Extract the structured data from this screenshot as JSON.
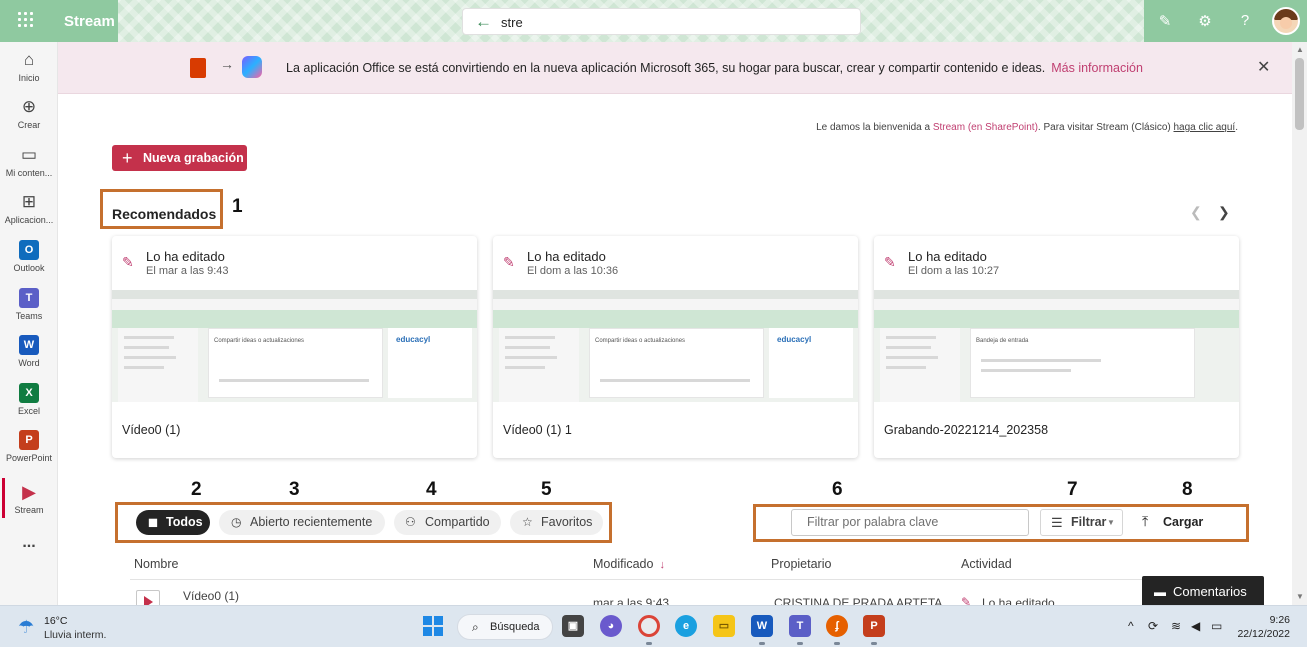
{
  "header": {
    "app_name": "Stream",
    "search_value": "stre",
    "icons": [
      "waffle-icon",
      "back-arrow-icon",
      "whats-new-icon",
      "settings-icon",
      "help-icon",
      "avatar"
    ]
  },
  "left_nav": {
    "items": [
      {
        "label": "Inicio",
        "icon": "home-icon"
      },
      {
        "label": "Crear",
        "icon": "create-icon"
      },
      {
        "label": "Mi conten...",
        "icon": "folder-icon"
      },
      {
        "label": "Aplicacion...",
        "icon": "apps-icon"
      },
      {
        "label": "Outlook",
        "icon": "outlook-icon"
      },
      {
        "label": "Teams",
        "icon": "teams-icon"
      },
      {
        "label": "Word",
        "icon": "word-icon"
      },
      {
        "label": "Excel",
        "icon": "excel-icon"
      },
      {
        "label": "PowerPoint",
        "icon": "powerpoint-icon"
      },
      {
        "label": "Stream",
        "icon": "stream-icon"
      }
    ],
    "more": "..."
  },
  "banner": {
    "text": "La aplicación Office se está convirtiendo en la nueva aplicación Microsoft 365, su hogar para buscar, crear y compartir contenido e ideas.",
    "link": "Más información"
  },
  "welcome": {
    "prefix": "Le damos la bienvenida a ",
    "link": "Stream (en SharePoint)",
    "middle": ". Para visitar Stream (Clásico) ",
    "action": "haga clic aquí",
    "suffix": "."
  },
  "new_recording_label": "Nueva grabación",
  "recommended": {
    "title": "Recomendados",
    "cards": [
      {
        "action": "Lo ha editado",
        "date": "El mar a las 9:43",
        "title": "Vídeo0 (1)",
        "thumb_heading": "Compartir ideas o actualizaciones"
      },
      {
        "action": "Lo ha editado",
        "date": "El dom a las 10:36",
        "title": "Vídeo0 (1) 1",
        "thumb_heading": "Compartir ideas o actualizaciones"
      },
      {
        "action": "Lo ha editado",
        "date": "El dom a las 10:27",
        "title": "Grabando-20221214_202358",
        "thumb_heading": "Bandeja de entrada"
      }
    ],
    "thumb_brand": "educacyl"
  },
  "filter_pills": [
    {
      "label": "Todos",
      "icon": "cube-icon",
      "active": true
    },
    {
      "label": "Abierto recientemente",
      "icon": "clock-icon",
      "active": false
    },
    {
      "label": "Compartido",
      "icon": "people-icon",
      "active": false
    },
    {
      "label": "Favoritos",
      "icon": "star-icon",
      "active": false
    }
  ],
  "toolbar": {
    "filter_placeholder": "Filtrar por palabra clave",
    "filter_label": "Filtrar",
    "upload_label": "Cargar"
  },
  "annotations": [
    "1",
    "2",
    "3",
    "4",
    "5",
    "6",
    "7",
    "8"
  ],
  "table": {
    "columns": [
      "Nombre",
      "Modificado",
      "Propietario",
      "Actividad"
    ],
    "rows": [
      {
        "name": "Vídeo0 (1)",
        "modified": "mar a las 9:43",
        "owner": "CRISTINA DE PRADA ARTETA",
        "activity": "Lo ha editado"
      }
    ]
  },
  "comments_label": "Comentarios",
  "taskbar": {
    "weather_temp": "16°C",
    "weather_desc": "Lluvia interm.",
    "search_label": "Búsqueda",
    "time": "9:26",
    "date": "22/12/2022"
  },
  "colors": {
    "accent": "#c4314b",
    "link": "#c03f71",
    "header_green": "#8fc9a0",
    "annotation_orange": "#c5702e"
  }
}
